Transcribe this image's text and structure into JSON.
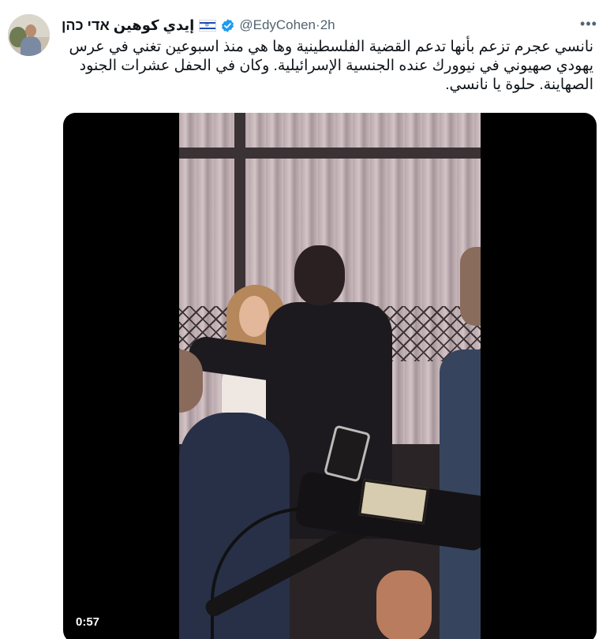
{
  "tweet": {
    "author_name": "إيدي كوهين אדי כהן",
    "flag_icon": "israel-flag-icon",
    "verified_icon": "verified-badge-icon",
    "verified_color": "#1d9bf0",
    "handle": "@EdyCohen",
    "separator": " · ",
    "time": "2h",
    "more_icon": "more-options-icon",
    "text": "نانسي عجرم تزعم بأنها تدعم القضية الفلسطينية وها هي منذ اسبوعين تغني في عرس يهودي صهيوني في نيوورك عنده الجنسية الإسرائيلية. وكان في الحفل عشرات الجنود الصهاينة. حلوة يا نانسي.",
    "media": {
      "type": "video",
      "duration": "0:57"
    }
  }
}
